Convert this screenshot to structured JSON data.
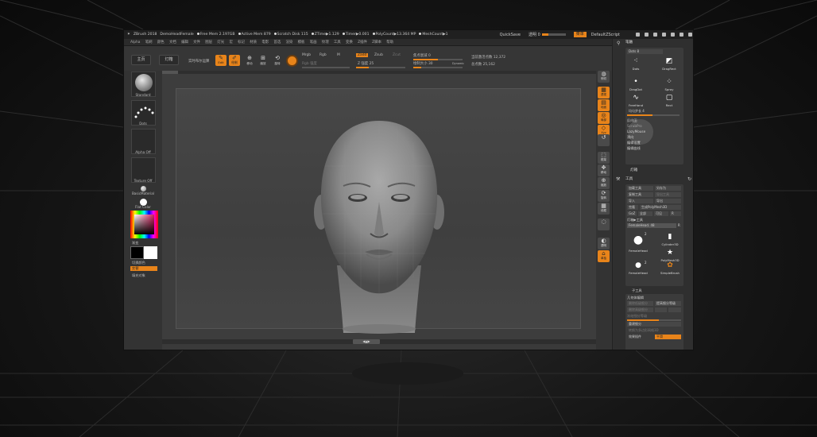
{
  "title_bar": {
    "app_name": "ZBrush 2018",
    "document": "DemoHeadFemale",
    "free_mem": "Free Mem 2.197GB",
    "active_mem": "Active Mem 879",
    "scratch_disk": "Scratch Disk 115",
    "ztime": "ZTime▶1.129",
    "timer": "Timer▶0.001",
    "polycount": "PolyCount▶13.364 MP",
    "meshcount": "MeshCount▶1",
    "quicksave": "QuickSave",
    "opacity_label": "透明 0",
    "menu_button": "菜单",
    "script": "DefaultZScript"
  },
  "menus": [
    "Alpha",
    "笔刷",
    "颜色",
    "文档",
    "编辑",
    "文件",
    "图层",
    "灯光",
    "宏",
    "标记",
    "材质",
    "电影",
    "首选",
    "渲染",
    "模板",
    "笔画",
    "纹理",
    "工具",
    "变换",
    "Z插件",
    "Z脚本",
    "帮助"
  ],
  "top_shelf": {
    "home_button": "主页",
    "lightbox_button": "灯箱",
    "live_boolean": "实时布尔运算",
    "edit_label": "Edit",
    "draw_label": "绘制",
    "move_label": "移动",
    "scale_label": "缩放",
    "rotate_label": "旋转",
    "mrgb": "Mrgb",
    "rgb": "Rgb",
    "m": "M",
    "rgb_intensity": "Rgb 强度",
    "zadd": "Zadd",
    "zsub": "Zsub",
    "zcut": "Zcut",
    "z_intensity": "Z 强度 25",
    "focal_shift": "焦点衰减 0",
    "draw_size": "绘制大小 30",
    "dynamic": "Dynamic",
    "active_points": "当前激活点数 12,372",
    "total_points": "总点数 25,162"
  },
  "left_shelf": {
    "brush": "Standard",
    "stroke": "Dots",
    "alpha": "Alpha Off",
    "texture": "Texture Off",
    "material": "BasicMaterial",
    "flat_color": "Flat Color",
    "gradient": "渐变",
    "switch_color": "切换颜色",
    "alternate": "交替",
    "fill": "填充对象"
  },
  "right_strip": [
    "侧切",
    "透视",
    "地面",
    "局部",
    "Xyz",
    "",
    "框架",
    "移动",
    "缩放",
    "旋转",
    "线框",
    "",
    "透明",
    "单独"
  ],
  "stroke_panel": {
    "title": "笔触",
    "dots_slider": "Dots  8",
    "stroke_types": [
      "Dots",
      "DragRect",
      "DragDot",
      "Spray",
      "FreeHand",
      "Rect"
    ],
    "lazy_step": "均匀步长 4",
    "options": [
      "反向田",
      "ScrubPro",
      "LazyMouse",
      "滑向",
      "编辑设置",
      "编辑曲线"
    ]
  },
  "lightbox_label": "灯箱",
  "tool_panel": {
    "title": "工具",
    "buttons": [
      [
        "加载工具",
        "另存为"
      ],
      [
        "复制工具",
        "导出工具"
      ],
      [
        "导入",
        "导出"
      ],
      [
        "克隆",
        "生成PolyMesh3D"
      ],
      [
        "GoZ",
        "全部",
        "可见",
        "R"
      ]
    ],
    "lightbox_tools": "灯箱▶工具",
    "current_tool": "FemaleHead. 48",
    "tools": [
      "FemaleHead",
      "Cylinder3D",
      "PolyMesh3D",
      "FemaleHead",
      "SimpleBrush"
    ],
    "badges": [
      "2",
      "2"
    ],
    "subtool": "子工具",
    "geometry": "几何体编辑",
    "geo_rows": [
      [
        "删除低级细分",
        "提高细分等级"
      ],
      [
        "删除高级细分",
        "",
        ""
      ],
      [
        "冻结细分等级"
      ],
      [
        "重建细分"
      ],
      [
        "转换为多边形网格3D"
      ],
      [
        "效果插件",
        "平滑"
      ]
    ]
  }
}
